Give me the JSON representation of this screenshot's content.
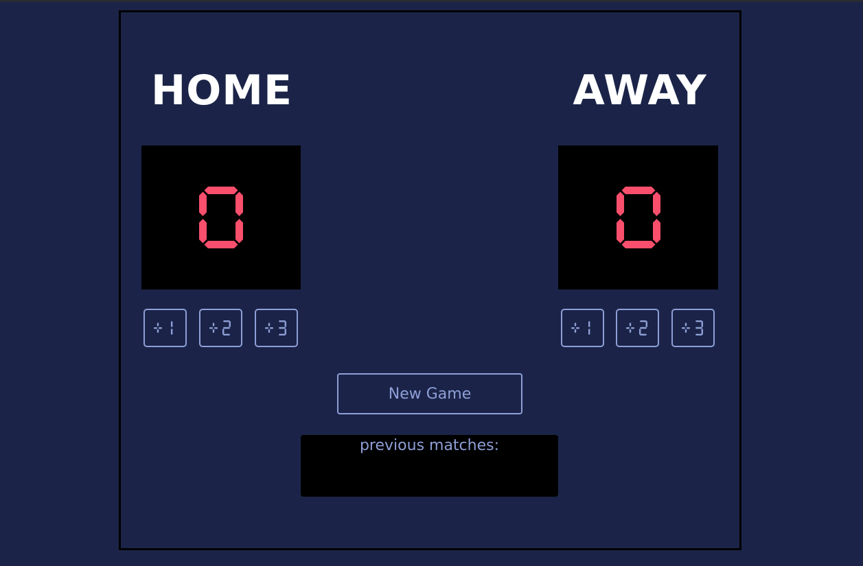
{
  "home": {
    "title": "HOME",
    "score": "0",
    "buttons": [
      "+1",
      "+2",
      "+3"
    ]
  },
  "away": {
    "title": "AWAY",
    "score": "0",
    "buttons": [
      "+1",
      "+2",
      "+3"
    ]
  },
  "controls": {
    "new_game_label": "New Game"
  },
  "history": {
    "label": "previous matches:"
  },
  "colors": {
    "background": "#1b2448",
    "score_digit": "#f94f6d",
    "accent": "#8f9fd7",
    "panel": "#000000"
  }
}
